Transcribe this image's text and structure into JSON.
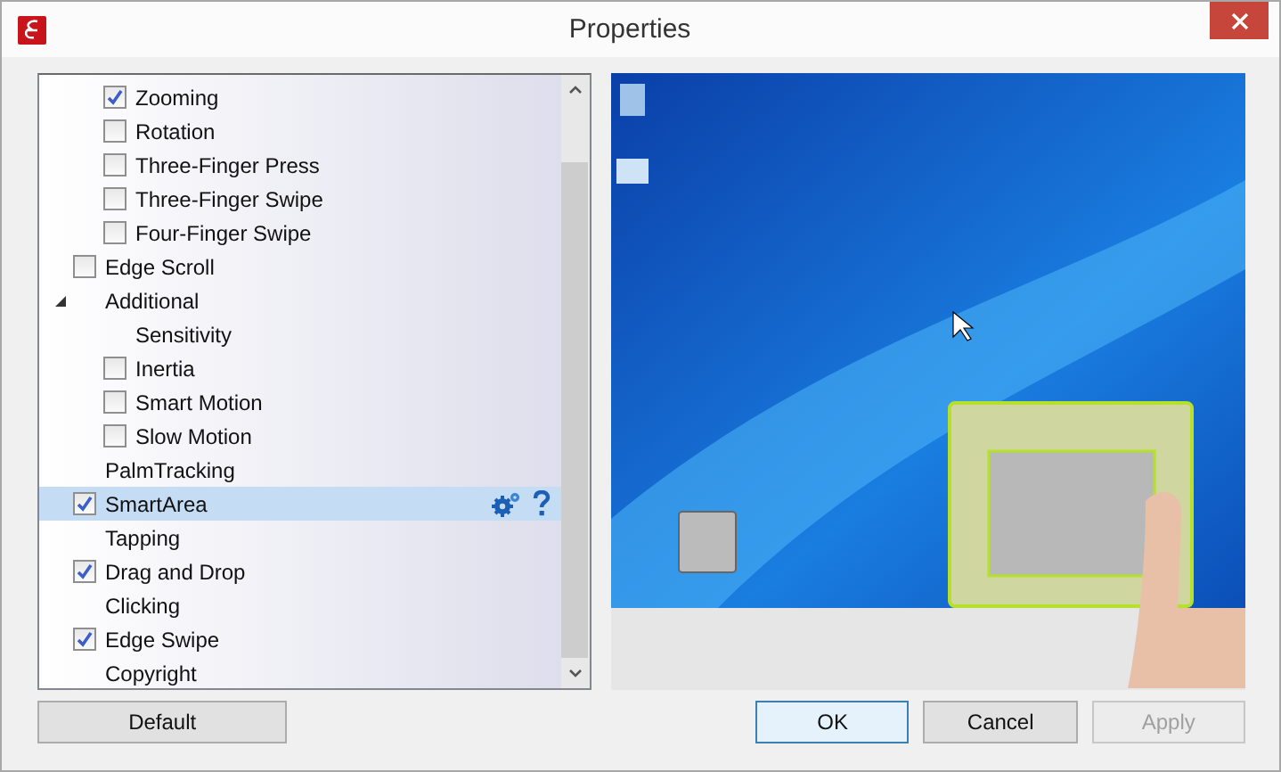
{
  "window": {
    "title": "Properties"
  },
  "tree": [
    {
      "kind": "continued",
      "children": [
        {
          "kind": "check",
          "label": "Zooming",
          "checked": true,
          "selected": false
        },
        {
          "kind": "check",
          "label": "Rotation",
          "checked": false,
          "selected": false
        },
        {
          "kind": "check",
          "label": "Three-Finger Press",
          "checked": false,
          "selected": false
        },
        {
          "kind": "check",
          "label": "Three-Finger Swipe",
          "checked": false,
          "selected": false
        },
        {
          "kind": "check",
          "label": "Four-Finger Swipe",
          "checked": false,
          "selected": false
        }
      ]
    },
    {
      "kind": "check",
      "label": "Edge Scroll",
      "checked": false,
      "selected": false
    },
    {
      "kind": "label",
      "label": "Additional",
      "selected": false,
      "expanded": true,
      "children": [
        {
          "kind": "label",
          "label": "Sensitivity",
          "selected": false
        },
        {
          "kind": "check",
          "label": "Inertia",
          "checked": false,
          "selected": false
        },
        {
          "kind": "check",
          "label": "Smart Motion",
          "checked": false,
          "selected": false
        },
        {
          "kind": "check",
          "label": "Slow Motion",
          "checked": false,
          "selected": false
        }
      ]
    },
    {
      "kind": "label",
      "label": "PalmTracking",
      "selected": false
    },
    {
      "kind": "check",
      "label": "SmartArea",
      "checked": true,
      "selected": true
    },
    {
      "kind": "label",
      "label": "Tapping",
      "selected": false
    },
    {
      "kind": "check",
      "label": "Drag and Drop",
      "checked": true,
      "selected": false
    },
    {
      "kind": "label",
      "label": "Clicking",
      "selected": false
    },
    {
      "kind": "check",
      "label": "Edge Swipe",
      "checked": true,
      "selected": false
    },
    {
      "kind": "label",
      "label": "Copyright",
      "selected": false
    }
  ],
  "buttons": [
    {
      "label": "Default",
      "kind": "left"
    },
    {
      "label": "OK",
      "kind": "default"
    },
    {
      "label": "Cancel",
      "kind": "normal"
    },
    {
      "label": "Apply",
      "kind": "disabled"
    }
  ]
}
